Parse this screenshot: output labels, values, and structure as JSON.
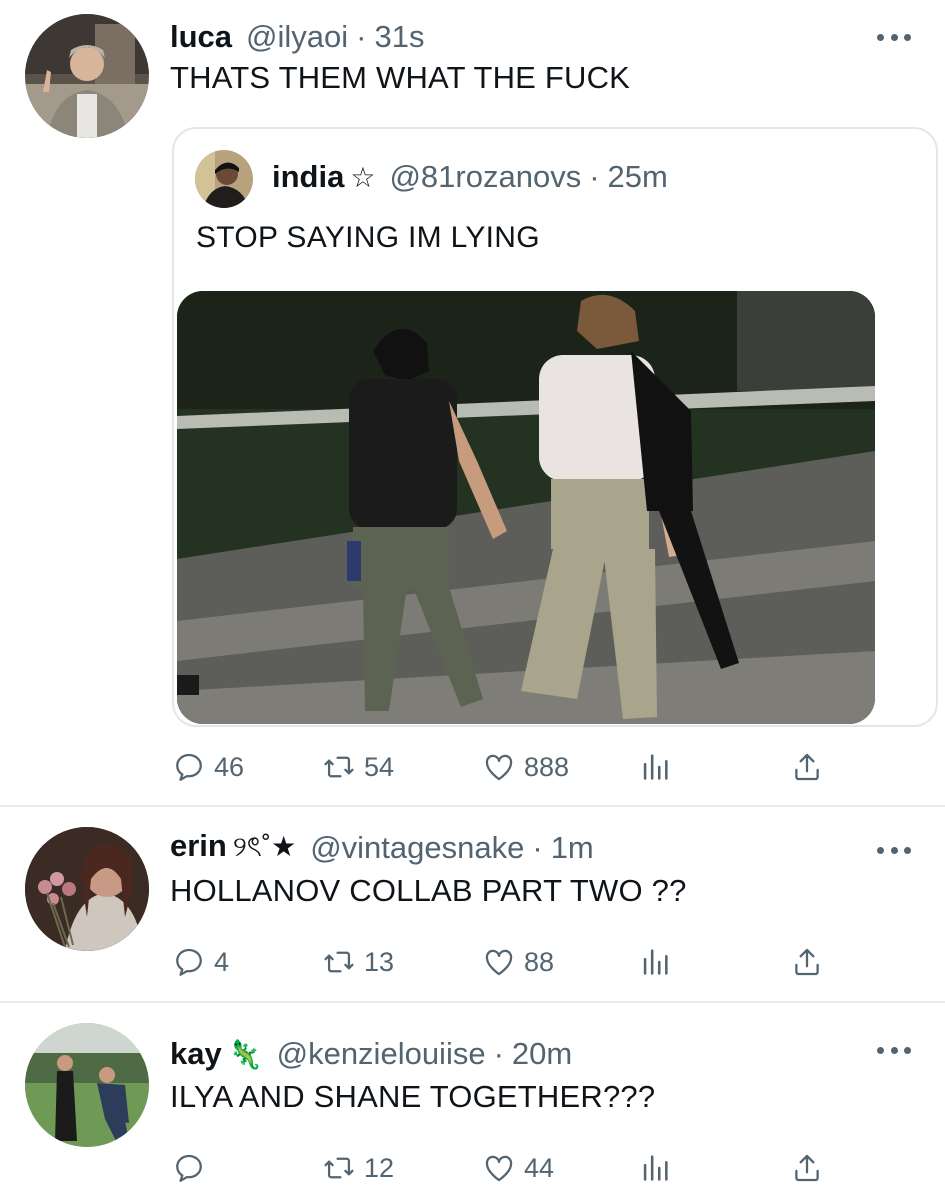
{
  "tweets": [
    {
      "name": "luca",
      "badge": "",
      "handle": "@ilyaoi",
      "separator": "·",
      "time": "31s",
      "text": "THATS THEM WHAT THE FUCK",
      "avatar_icon": "avatar-photo-luca",
      "quote": {
        "name": "india",
        "badge": "☆",
        "handle": "@81rozanovs",
        "separator": "·",
        "time": "25m",
        "text": "STOP SAYING IM LYING",
        "media_icon": "photo-people-walking"
      },
      "stats": {
        "replies": "46",
        "retweets": "54",
        "likes": "888"
      }
    },
    {
      "name": "erin",
      "badge": "୨ৎ˚★",
      "handle": "@vintagesnake",
      "separator": "·",
      "time": "1m",
      "text": "HOLLANOV COLLAB PART TWO ??",
      "avatar_icon": "avatar-photo-erin",
      "stats": {
        "replies": "4",
        "retweets": "13",
        "likes": "88"
      }
    },
    {
      "name": "kay",
      "badge": "🦎",
      "handle": "@kenzielouiise",
      "separator": "·",
      "time": "20m",
      "text": "ILYA AND SHANE TOGETHER???",
      "avatar_icon": "avatar-photo-kay",
      "stats": {
        "replies": "",
        "retweets": "12",
        "likes": "44"
      }
    }
  ],
  "icons": {
    "reply": "reply-icon",
    "retweet": "retweet-icon",
    "like": "heart-icon",
    "stats": "analytics-icon",
    "share": "share-icon",
    "more": "more-icon"
  },
  "colors": {
    "text": "#0f1419",
    "secondary": "#536471",
    "divider": "#e9ecef",
    "border": "#e1e8ed"
  }
}
